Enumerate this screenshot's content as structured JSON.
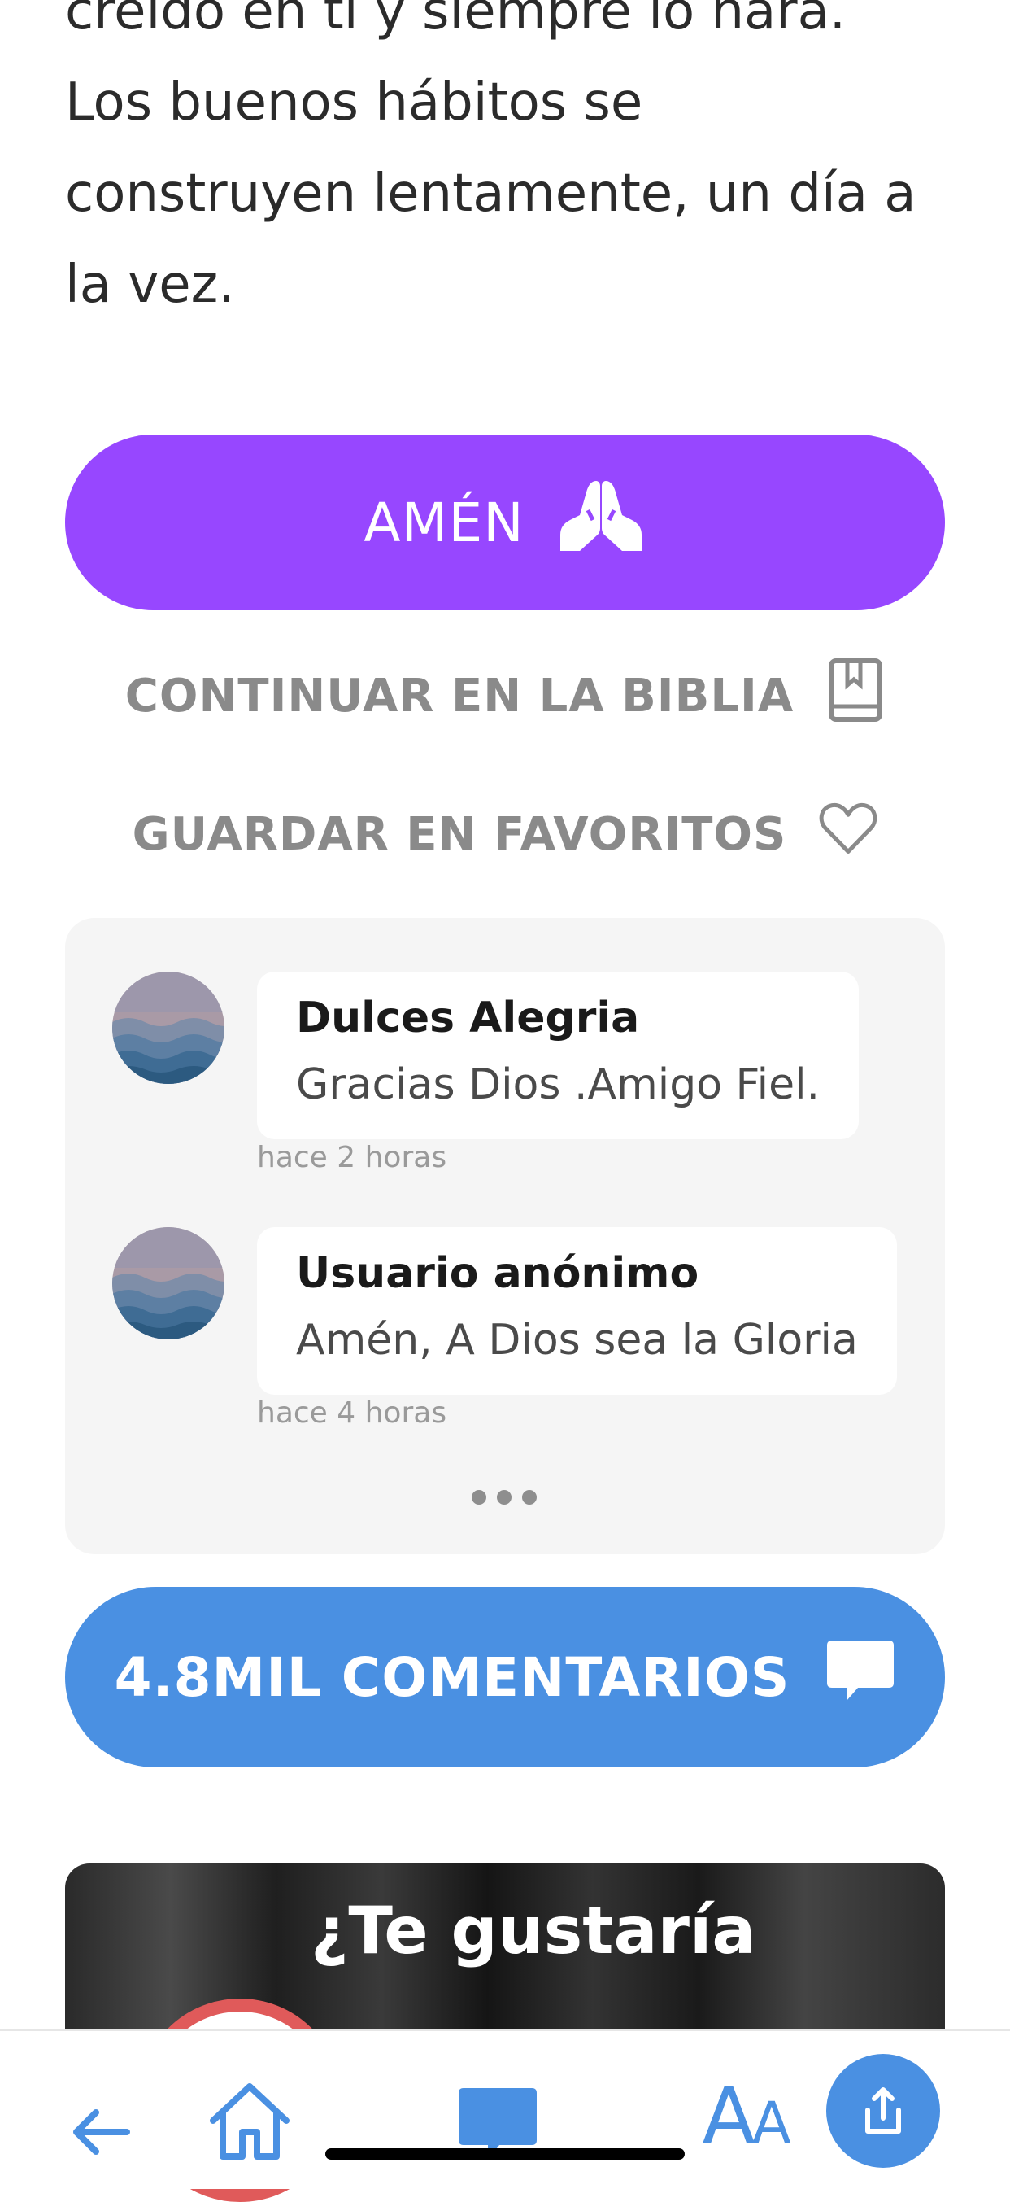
{
  "devotional": {
    "lines": [
      "creído en tí y siempre lo hará.",
      "Los buenos hábitos se",
      "construyen lentamente, un día a",
      "la vez."
    ]
  },
  "actions": {
    "amen_label": "AMÉN",
    "bible_label": "CONTINUAR EN LA BIBLIA",
    "favorites_label": "GUARDAR EN FAVORITOS"
  },
  "comments": [
    {
      "author": "Dulces Alegria",
      "text": "Gracias Dios .Amigo Fiel.",
      "time": "hace 2 horas"
    },
    {
      "author": "Usuario anónimo",
      "text": "Amén,  A Dios sea la Gloria",
      "time": "hace 4 horas"
    }
  ],
  "comments_button": {
    "label": "4.8MIL COMENTARIOS"
  },
  "promo": {
    "title": "¿Te gustaría"
  },
  "bottom_nav": {
    "text_size_big": "A",
    "text_size_small": "A",
    "items": [
      "back-arrow-icon",
      "home-icon",
      "comment-icon",
      "text-size-icon",
      "share-icon"
    ]
  },
  "colors": {
    "amen": "#9747ff",
    "comments_button": "#4a90e2",
    "accent": "#4a90e2",
    "link_gray": "#8a8a8a"
  }
}
